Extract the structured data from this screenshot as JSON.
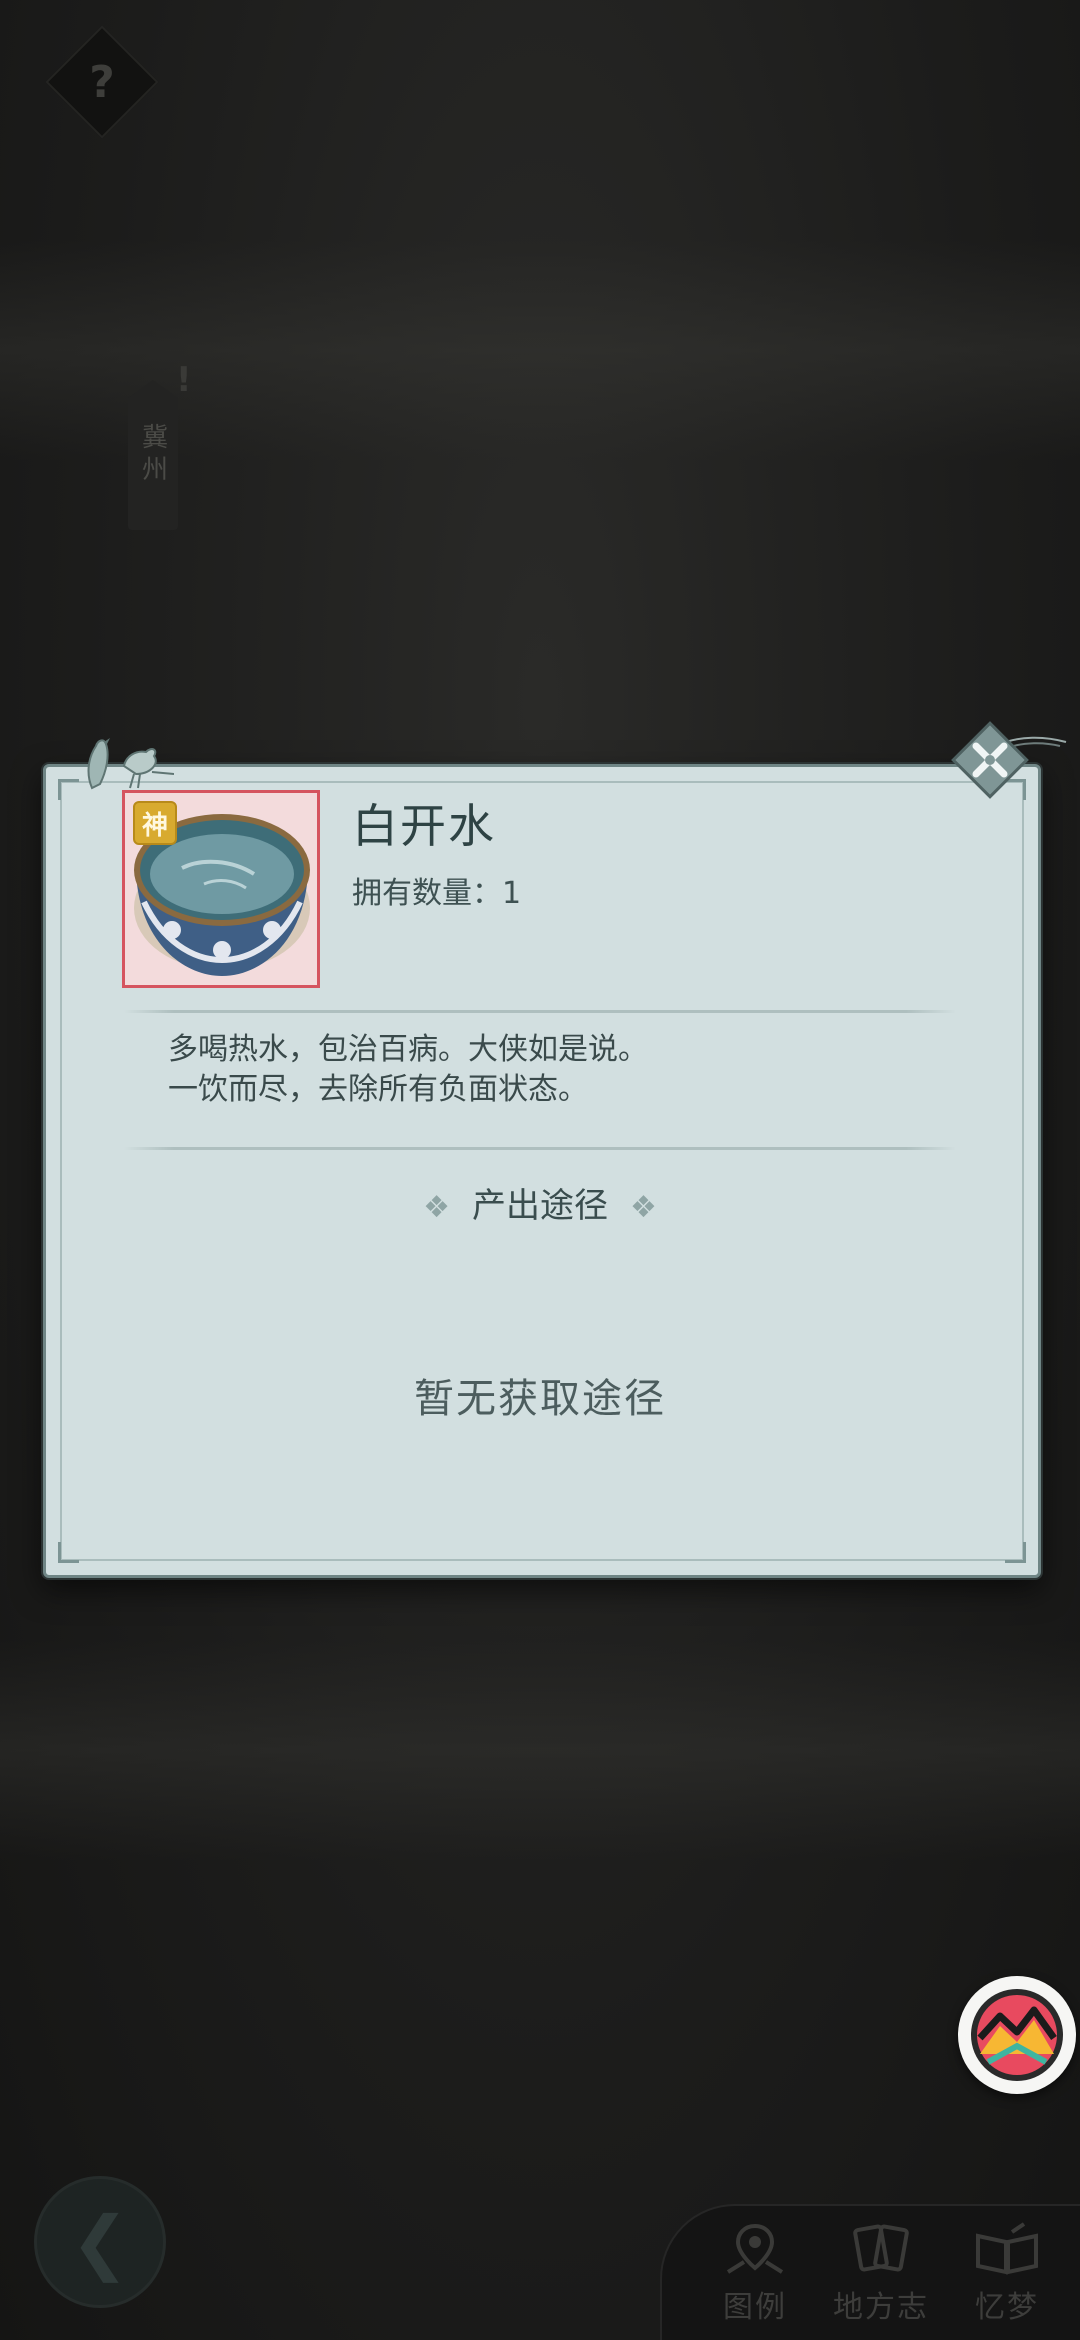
{
  "background": {
    "region_tag": "冀州",
    "region_alert": "!",
    "help_symbol": "?"
  },
  "dialog": {
    "item": {
      "name": "白开水",
      "grade_badge": "神",
      "count_label": "拥有数量：",
      "count_value": "1",
      "icon": "porcelain-bowl-icon"
    },
    "description_lines": [
      "多喝热水，包治百病。大侠如是说。",
      "一饮而尽，去除所有负面状态。"
    ],
    "source_section": {
      "title": "产出途径",
      "decoration": "❖",
      "empty_text": "暂无获取途径"
    },
    "close_icon": "close-x-icon"
  },
  "bottom_nav": {
    "items": [
      {
        "label": "图例",
        "icon": "map-pin-icon"
      },
      {
        "label": "地方志",
        "icon": "cards-icon"
      },
      {
        "label": "忆梦",
        "icon": "book-icon"
      }
    ],
    "back_icon": "back-arrow-icon"
  },
  "floating_button": {
    "icon": "mountain-logo-icon"
  },
  "colors": {
    "dialog_bg": "#d2dfe0",
    "dialog_border": "#6f8585",
    "item_frame": "#d5545f",
    "grade_badge": "#d8aa2f",
    "text_dark": "#2e4344"
  }
}
